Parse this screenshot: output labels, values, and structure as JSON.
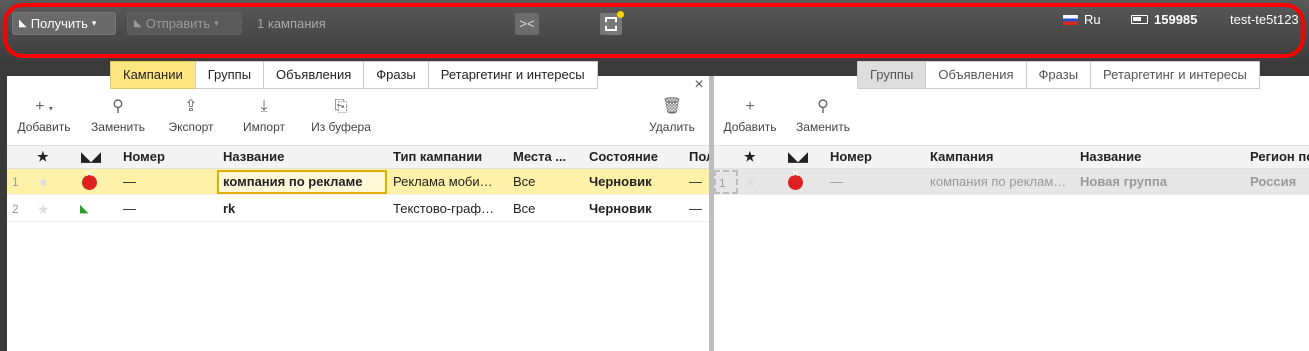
{
  "toolbar": {
    "get_label": "Получить",
    "send_label": "Отправить",
    "campaign_count": "1 кампания",
    "collapse_icon": "><",
    "lang": "Ru",
    "balance": "159985",
    "user": "test-te5t123"
  },
  "left": {
    "tabs": [
      "Кампании",
      "Группы",
      "Объявления",
      "Фразы",
      "Ретаргетинг и интересы"
    ],
    "tools": {
      "add": "Добавить",
      "replace": "Заменить",
      "export": "Экспорт",
      "import": "Импорт",
      "from_buffer": "Из буфера",
      "delete": "Удалить"
    },
    "headers": {
      "star": "★",
      "number": "Номер",
      "name": "Название",
      "type": "Тип кампании",
      "places": "Места ...",
      "state": "Состояние",
      "more": "Пол"
    },
    "rows": [
      {
        "idx": "1",
        "number": "—",
        "name": "компания по рекламе",
        "type": "Реклама моби…",
        "places": "Все",
        "state": "Черновик",
        "more": "—"
      },
      {
        "idx": "2",
        "number": "—",
        "name": "rk",
        "type": "Текстово-граф…",
        "places": "Все",
        "state": "Черновик",
        "more": "—"
      }
    ]
  },
  "right": {
    "tabs": [
      "Группы",
      "Объявления",
      "Фразы",
      "Ретаргетинг и интересы"
    ],
    "tools": {
      "add": "Добавить",
      "replace": "Заменить"
    },
    "headers": {
      "star": "★",
      "number": "Номер",
      "campaign": "Кампания",
      "name": "Название",
      "region": "Регион по"
    },
    "rows": [
      {
        "idx": "1",
        "number": "—",
        "campaign": "компания по реклам…",
        "name": "Новая группа",
        "region": "Россия"
      }
    ]
  }
}
